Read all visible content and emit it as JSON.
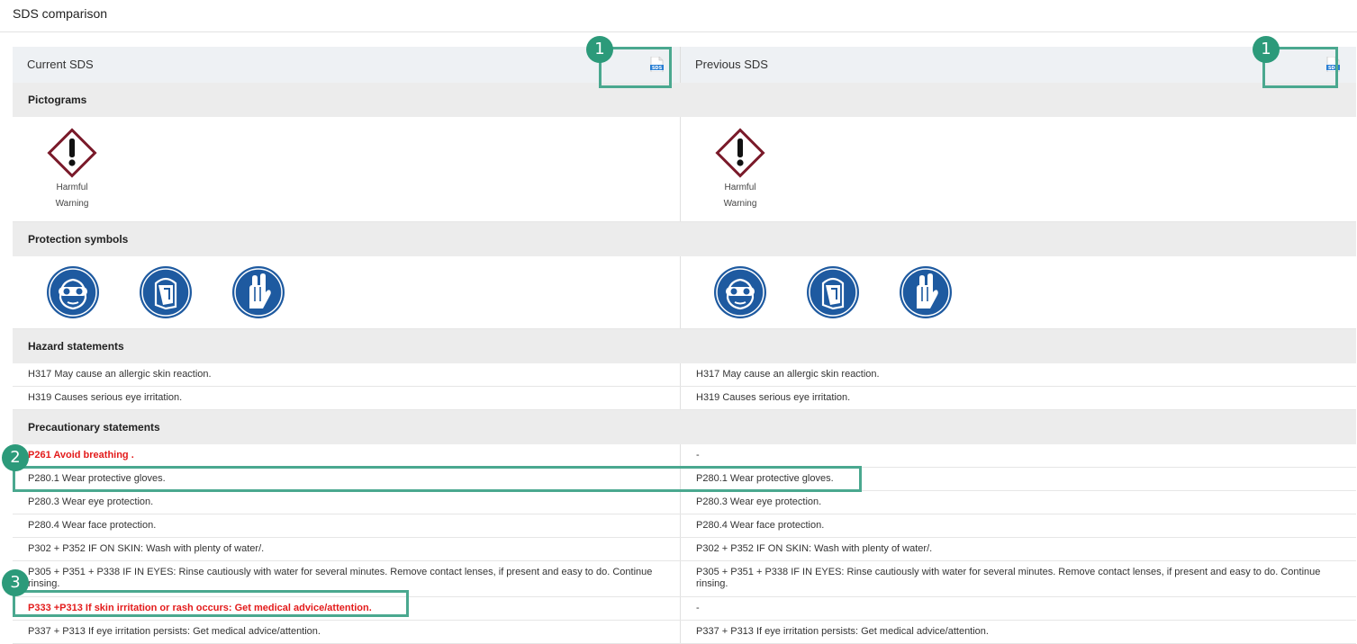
{
  "page": {
    "title": "SDS comparison"
  },
  "columns": {
    "current": "Current SDS",
    "previous": "Previous SDS"
  },
  "doc_icon_label": "SDS",
  "sections": {
    "pictograms": "Pictograms",
    "protection": "Protection symbols",
    "hazard": "Hazard statements",
    "precautionary": "Precautionary statements"
  },
  "pictogram": {
    "name": "Harmful",
    "signal": "Warning",
    "icon": "exclamation-diamond-icon"
  },
  "protection_icons": [
    "safety-goggles-icon",
    "face-shield-icon",
    "protective-gloves-icon"
  ],
  "hazard_statements": {
    "current": [
      "H317 May cause an allergic skin reaction.",
      "H319 Causes serious eye irritation."
    ],
    "previous": [
      "H317 May cause an allergic skin reaction.",
      "H319 Causes serious eye irritation."
    ]
  },
  "precautionary": [
    {
      "current": "P261 Avoid breathing .",
      "previous": "-",
      "changed": true
    },
    {
      "current": "P280.1 Wear protective gloves.",
      "previous": "P280.1 Wear protective gloves."
    },
    {
      "current": "P280.3 Wear eye protection.",
      "previous": "P280.3 Wear eye protection."
    },
    {
      "current": "P280.4 Wear face protection.",
      "previous": "P280.4 Wear face protection."
    },
    {
      "current": "P302 + P352 IF ON SKIN: Wash with plenty of water/.",
      "previous": "P302 + P352 IF ON SKIN: Wash with plenty of water/."
    },
    {
      "current": "P305 + P351 + P338 IF IN EYES: Rinse cautiously with water for several minutes. Remove contact lenses, if present and easy to do. Continue rinsing.",
      "previous": "P305 + P351 + P338 IF IN EYES: Rinse cautiously with water for several minutes. Remove contact lenses, if present and easy to do. Continue rinsing."
    },
    {
      "current": "P333 +P313 If skin irritation or rash occurs: Get medical advice/attention.",
      "previous": "-",
      "changed": true
    },
    {
      "current": "P337 + P313 If eye irritation persists: Get medical advice/attention.",
      "previous": "P337 + P313 If eye irritation persists: Get medical advice/attention."
    }
  ],
  "callouts": [
    "1",
    "1",
    "2",
    "3"
  ],
  "colors": {
    "accent": "#2c9a7a",
    "changed_text": "#e31b1b",
    "header_bg": "#eef1f4",
    "section_bg": "#ececec",
    "pictogram_border": "#7a1a2a",
    "protection_blue": "#1e5aa0"
  }
}
